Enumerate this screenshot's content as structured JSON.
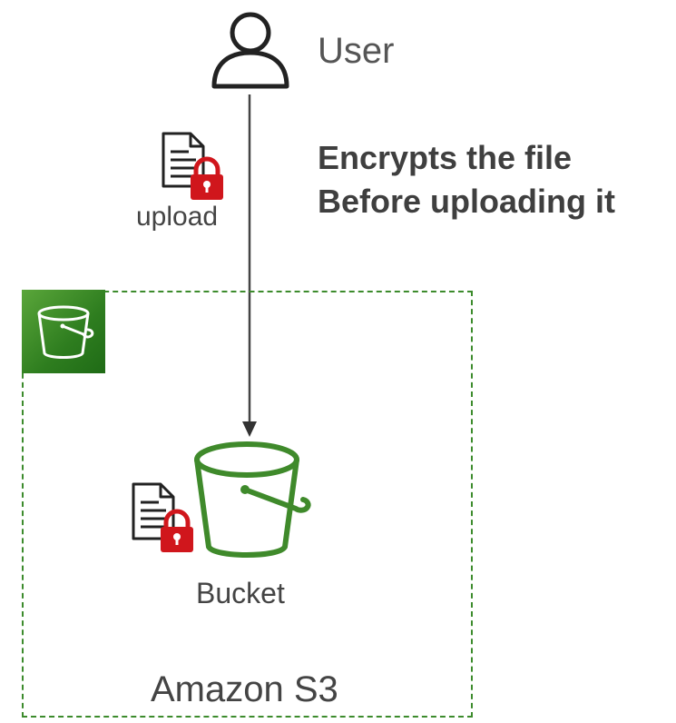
{
  "user": {
    "label": "User",
    "icon": "user-icon"
  },
  "note": {
    "line1": "Encrypts the file",
    "line2": "Before uploading it"
  },
  "upload": {
    "label": "upload",
    "icon": "locked-document-icon"
  },
  "group": {
    "label": "Amazon S3",
    "badge_icon": "s3-bucket-icon",
    "border_color": "#3c8b2c"
  },
  "bucket": {
    "label": "Bucket",
    "icon": "bucket-icon",
    "color": "#3f8a2b"
  },
  "stored_object": {
    "icon": "locked-document-icon"
  },
  "colors": {
    "lock": "#d0161c",
    "accent_green": "#3f8a2b",
    "text": "#444444"
  }
}
